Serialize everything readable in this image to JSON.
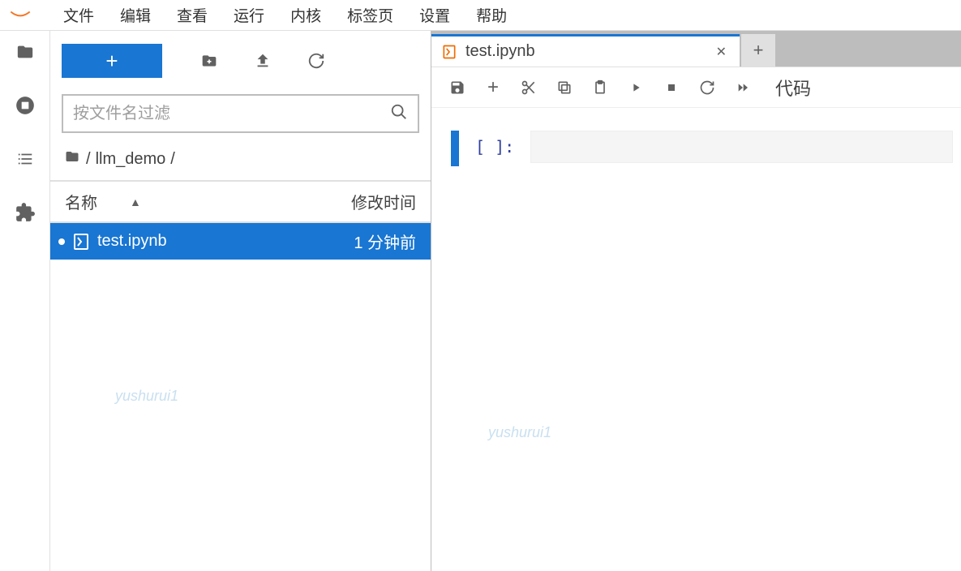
{
  "menu": [
    "文件",
    "编辑",
    "查看",
    "运行",
    "内核",
    "标签页",
    "设置",
    "帮助"
  ],
  "file_panel": {
    "filter_placeholder": "按文件名过滤",
    "breadcrumb": [
      "/",
      "llm_demo",
      "/"
    ],
    "columns": {
      "name": "名称",
      "modified": "修改时间"
    },
    "files": [
      {
        "name": "test.ipynb",
        "modified": "1 分钟前"
      }
    ]
  },
  "tab": {
    "title": "test.ipynb"
  },
  "notebook": {
    "cell_type_label": "代码",
    "prompt": "[ ]:"
  },
  "watermark": "yushurui1"
}
